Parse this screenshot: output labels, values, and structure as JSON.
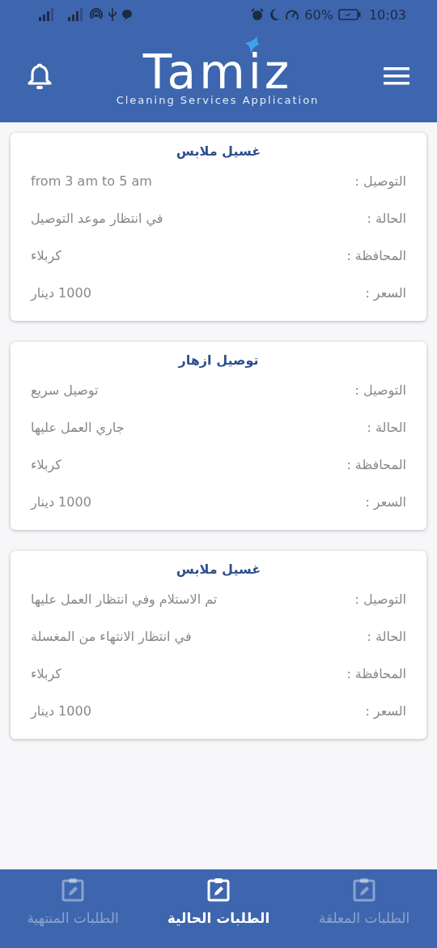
{
  "status_bar": {
    "battery": "60%",
    "time": "10:03"
  },
  "header": {
    "logo": "Tamiz",
    "tagline": "Cleaning Services Application"
  },
  "orders": [
    {
      "title": "غسيل ملابس",
      "fields": [
        {
          "label": "التوصيل :",
          "value": "from 3 am to 5 am"
        },
        {
          "label": "الحالة :",
          "value": "في انتظار موعد التوصيل"
        },
        {
          "label": "المحافظة :",
          "value": "كربلاء"
        },
        {
          "label": "السعر :",
          "value": "1000 دينار"
        }
      ]
    },
    {
      "title": "توصيل ازهار",
      "fields": [
        {
          "label": "التوصيل :",
          "value": "توصيل سريع"
        },
        {
          "label": "الحالة :",
          "value": "جاري العمل عليها"
        },
        {
          "label": "المحافظة :",
          "value": "كربلاء"
        },
        {
          "label": "السعر :",
          "value": "1000 دينار"
        }
      ]
    },
    {
      "title": "غسيل ملابس",
      "fields": [
        {
          "label": "التوصيل :",
          "value": "تم الاستلام وفي انتظار العمل عليها"
        },
        {
          "label": "الحالة :",
          "value": "في انتظار الانتهاء من المغسلة"
        },
        {
          "label": "المحافظة :",
          "value": "كربلاء"
        },
        {
          "label": "السعر :",
          "value": "1000 دينار"
        }
      ]
    }
  ],
  "bottom_nav": [
    {
      "label": "الطلبات المعلقة",
      "selected": false
    },
    {
      "label": "الطلبات الحالية",
      "selected": true
    },
    {
      "label": "الطلبات المنتهية",
      "selected": false
    }
  ]
}
